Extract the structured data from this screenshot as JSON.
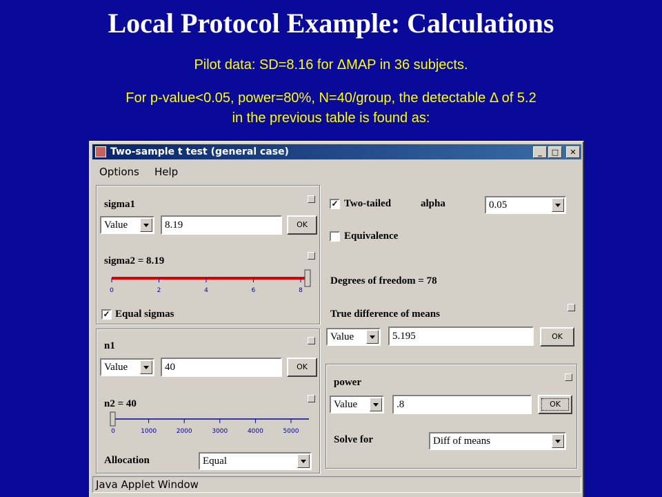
{
  "slide": {
    "title": "Local Protocol Example:  Calculations",
    "line1": "Pilot data: SD=8.16 for ΔMAP in 36 subjects.",
    "line2": "For p-value<0.05, power=80%, N=40/group, the detectable Δ of 5.2",
    "line3": "in the previous table is found as:"
  },
  "window": {
    "title": "Two-sample t test (general case)",
    "minimize": "_",
    "maximize": "□",
    "close": "✕",
    "menu": [
      "Options",
      "Help"
    ],
    "status": "Java Applet Window"
  },
  "sigma1": {
    "label": "sigma1",
    "mode": "Value",
    "value": "8.19",
    "ok": "OK"
  },
  "sigma2": {
    "label": "sigma2 = 8.19",
    "ticks": [
      "0",
      "2",
      "4",
      "6",
      "8"
    ],
    "level": 8.19,
    "max": 8.19
  },
  "equal_sigmas": {
    "label": "Equal sigmas",
    "checked": true
  },
  "n1": {
    "label": "n1",
    "mode": "Value",
    "value": "40",
    "ok": "OK"
  },
  "n2": {
    "label": "n2 = 40",
    "ticks": [
      "0",
      "1000",
      "2000",
      "3000",
      "4000",
      "5000"
    ],
    "level": 40
  },
  "allocation": {
    "label": "Allocation",
    "value": "Equal"
  },
  "two_tailed": {
    "label": "Two-tailed",
    "checked": true
  },
  "alpha": {
    "label": "alpha",
    "value": "0.05"
  },
  "equivalence": {
    "label": "Equivalence",
    "checked": false
  },
  "dof": {
    "label": "Degrees of freedom = 78"
  },
  "true_diff": {
    "label": "True difference of means",
    "mode": "Value",
    "value": "5.195",
    "ok": "OK"
  },
  "power": {
    "label": "power",
    "mode": "Value",
    "value": ".8",
    "ok": "OK"
  },
  "solve_for": {
    "label": "Solve for",
    "value": "Diff of means"
  },
  "colors": {
    "background": "#0a0a9a",
    "title": "#ffffff",
    "subtitle": "#ffff00",
    "slider_red": "#dd0000",
    "slider_blue": "#0000a0"
  }
}
